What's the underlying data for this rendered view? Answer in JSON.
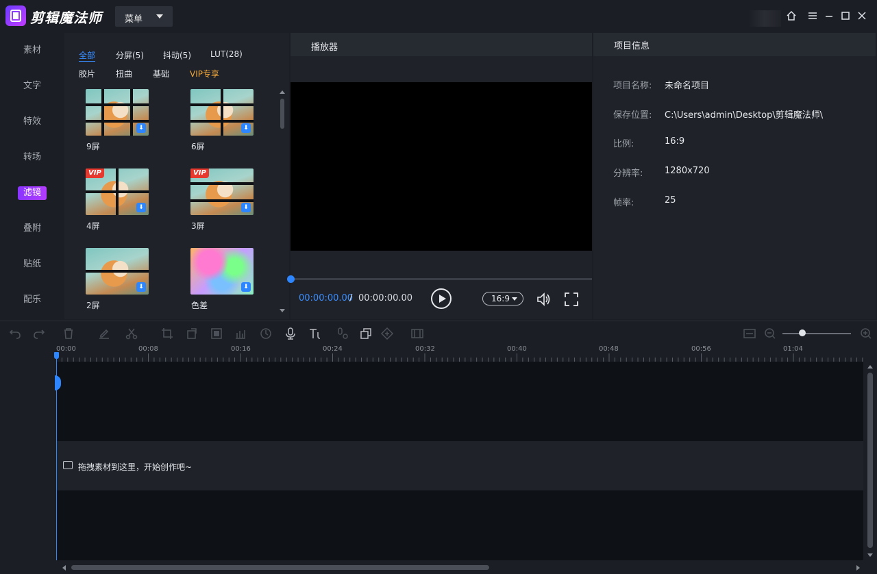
{
  "app": {
    "title": "剪辑魔法师",
    "menu_label": "菜单"
  },
  "left_nav": [
    {
      "label": "素材"
    },
    {
      "label": "文字"
    },
    {
      "label": "特效"
    },
    {
      "label": "转场"
    },
    {
      "label": "滤镜",
      "active": true
    },
    {
      "label": "叠附"
    },
    {
      "label": "贴纸"
    },
    {
      "label": "配乐"
    }
  ],
  "effects": {
    "categories_row1": [
      "全部",
      "分屏(5)",
      "抖动(5)",
      "LUT(28)"
    ],
    "categories_row2": [
      "胶片",
      "扭曲",
      "基础",
      "VIP专享"
    ],
    "items": [
      {
        "label": "9屏",
        "vip": false,
        "download": true
      },
      {
        "label": "6屏",
        "vip": false,
        "download": true
      },
      {
        "label": "4屏",
        "vip": true,
        "download": true
      },
      {
        "label": "3屏",
        "vip": true,
        "download": true
      },
      {
        "label": "2屏",
        "vip": false,
        "download": true
      },
      {
        "label": "色差",
        "vip": false,
        "download": true
      }
    ],
    "vip_badge": "VIP"
  },
  "player": {
    "title": "播放器",
    "current_time": "00:00:00.00",
    "separator": "/",
    "total_time": "00:00:00.00",
    "ratio": "16:9"
  },
  "project_info": {
    "title": "项目信息",
    "fields": [
      {
        "key": "项目名称:",
        "value": "未命名项目"
      },
      {
        "key": "保存位置:",
        "value": "C:\\Users\\admin\\Desktop\\剪辑魔法师\\"
      },
      {
        "key": "比例:",
        "value": "16:9"
      },
      {
        "key": "分辨率:",
        "value": "1280x720"
      },
      {
        "key": "帧率:",
        "value": "25"
      }
    ]
  },
  "timeline": {
    "ticks": [
      "00:00",
      "00:08",
      "00:16",
      "00:24",
      "00:32",
      "00:40",
      "00:48",
      "00:56",
      "01:04"
    ],
    "drop_hint": "拖拽素材到这里，开始创作吧~"
  },
  "colors": {
    "accent": "#2e86ff",
    "nav_active": "#9b38ff",
    "vip": "#f0a53a"
  }
}
